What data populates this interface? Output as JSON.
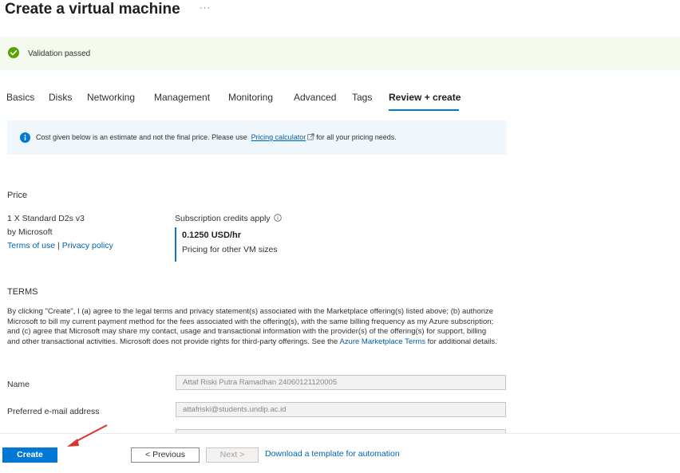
{
  "page": {
    "title": "Create a virtual machine",
    "more_label": "···"
  },
  "validation": {
    "status_icon": "check-circle-icon",
    "text": "Validation passed",
    "color": "#57a300"
  },
  "tabs": [
    {
      "label": "Basics"
    },
    {
      "label": "Disks"
    },
    {
      "label": "Networking"
    },
    {
      "label": "Management"
    },
    {
      "label": "Monitoring"
    },
    {
      "label": "Advanced"
    },
    {
      "label": "Tags"
    },
    {
      "label": "Review + create",
      "active": true
    }
  ],
  "info": {
    "icon": "info-icon",
    "text_before": "Cost given below is an estimate and not the final price. Please use",
    "link": "Pricing calculator",
    "link_icon": "external-link-icon",
    "text_after": "for all your pricing needs."
  },
  "price": {
    "heading": "Price",
    "product": "1 X Standard D2s v3",
    "publisher": "by Microsoft",
    "terms_link": "Terms of use",
    "separator": "|",
    "privacy_link": "Privacy policy",
    "credits_label": "Subscription credits apply",
    "credits_icon": "info-circle-icon",
    "rate": "0.1250 USD/hr",
    "other_sizes_link": "Pricing for other VM sizes"
  },
  "terms": {
    "heading": "TERMS",
    "body": "By clicking \"Create\", I (a) agree to the legal terms and privacy statement(s) associated with the Marketplace offering(s) listed above; (b) authorize Microsoft to bill my current payment method for the fees associated with the offering(s), with the same billing frequency as my Azure subscription; and (c) agree that Microsoft may share my contact, usage and transactional information with the provider(s) of the offering(s) for support, billing and other transactional activities. Microsoft does not provide rights for third-party offerings. See the",
    "marketplace_link": "Azure Marketplace Terms",
    "body_end": "for additional details."
  },
  "fields": {
    "name_label": "Name",
    "name_value": "Attaf Riski Putra Ramadhan 24060121120005",
    "email_label": "Preferred e-mail address",
    "email_value": "attafriski@students.undip.ac.id"
  },
  "footer": {
    "create": "Create",
    "previous": "< Previous",
    "next": "Next >",
    "download_link": "Download a template for automation"
  },
  "colors": {
    "accent": "#0078d4",
    "link": "#0062ad",
    "success_bg": "#f4fbee",
    "info_bg": "#eff6fc",
    "annotation_arrow": "#d9342b"
  }
}
